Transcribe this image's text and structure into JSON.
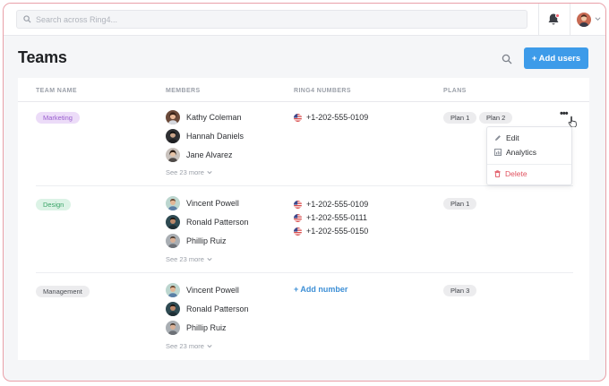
{
  "search": {
    "placeholder": "Search across Ring4..."
  },
  "page": {
    "title": "Teams",
    "add_users_label": "+ Add users"
  },
  "table": {
    "headers": [
      "TEAM NAME",
      "MEMBERS",
      "RING4 NUMBERS",
      "PLANS"
    ],
    "rows": [
      {
        "team": "Marketing",
        "members": [
          "Kathy Coleman",
          "Hannah Daniels",
          "Jane Alvarez"
        ],
        "see_more": "See 23 more",
        "numbers": [
          "+1-202-555-0109"
        ],
        "plans": [
          "Plan 1",
          "Plan 2"
        ]
      },
      {
        "team": "Design",
        "members": [
          "Vincent Powell",
          "Ronald Patterson",
          "Phillip Ruiz"
        ],
        "see_more": "See 23 more",
        "numbers": [
          "+1-202-555-0109",
          "+1-202-555-0111",
          "+1-202-555-0150"
        ],
        "plans": [
          "Plan 1"
        ]
      },
      {
        "team": "Management",
        "members": [
          "Vincent Powell",
          "Ronald Patterson",
          "Phillip Ruiz"
        ],
        "see_more": "See 23 more",
        "add_number": "+ Add number",
        "plans": [
          "Plan 3"
        ]
      }
    ]
  },
  "menu": {
    "edit": "Edit",
    "analytics": "Analytics",
    "delete": "Delete"
  },
  "colors": {
    "accent": "#3d9be9",
    "danger": "#e0525f",
    "marketing": "#9a5fcf",
    "design": "#3aa468"
  },
  "icons": [
    "search-icon",
    "bell-icon",
    "chevron-down-icon",
    "more-icon",
    "pencil-icon",
    "analytics-icon",
    "trash-icon",
    "us-flag-icon",
    "pointer-cursor-icon"
  ]
}
